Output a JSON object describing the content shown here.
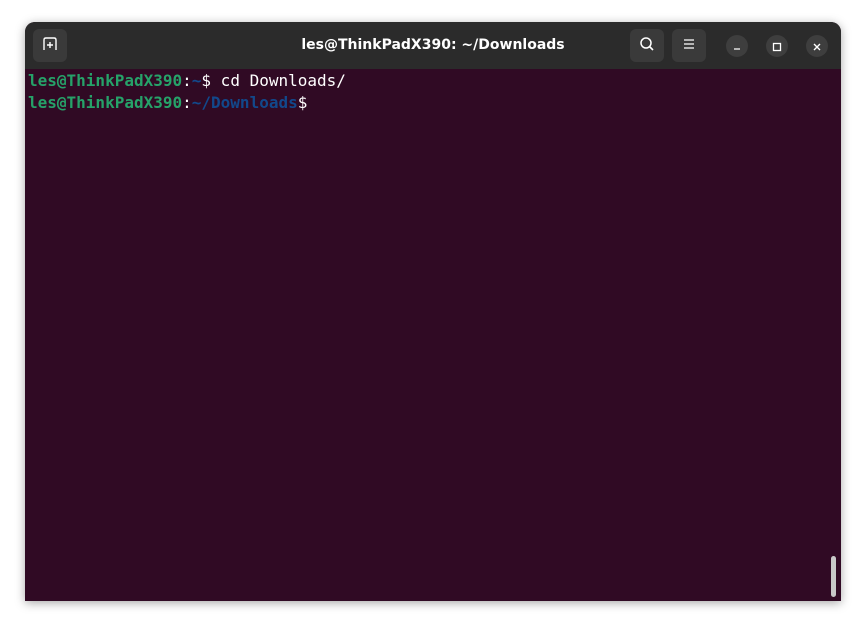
{
  "window": {
    "title": "les@ThinkPadX390: ~/Downloads"
  },
  "header": {
    "new_tab_icon": "new-tab-icon",
    "search_icon": "search-icon",
    "menu_icon": "hamburger-menu-icon",
    "minimize_icon": "minimize-icon",
    "maximize_icon": "maximize-icon",
    "close_icon": "close-icon"
  },
  "terminal": {
    "lines": [
      {
        "user": "les@ThinkPadX390",
        "sep": ":",
        "path": "~",
        "prompt": "$",
        "command": " cd Downloads/"
      },
      {
        "user": "les@ThinkPadX390",
        "sep": ":",
        "path": "~/Downloads",
        "prompt": "$",
        "command": ""
      }
    ]
  },
  "colors": {
    "background": "#300a24",
    "titlebar": "#2b2b2b",
    "user": "#26a269",
    "path": "#12488b",
    "text": "#ffffff"
  }
}
